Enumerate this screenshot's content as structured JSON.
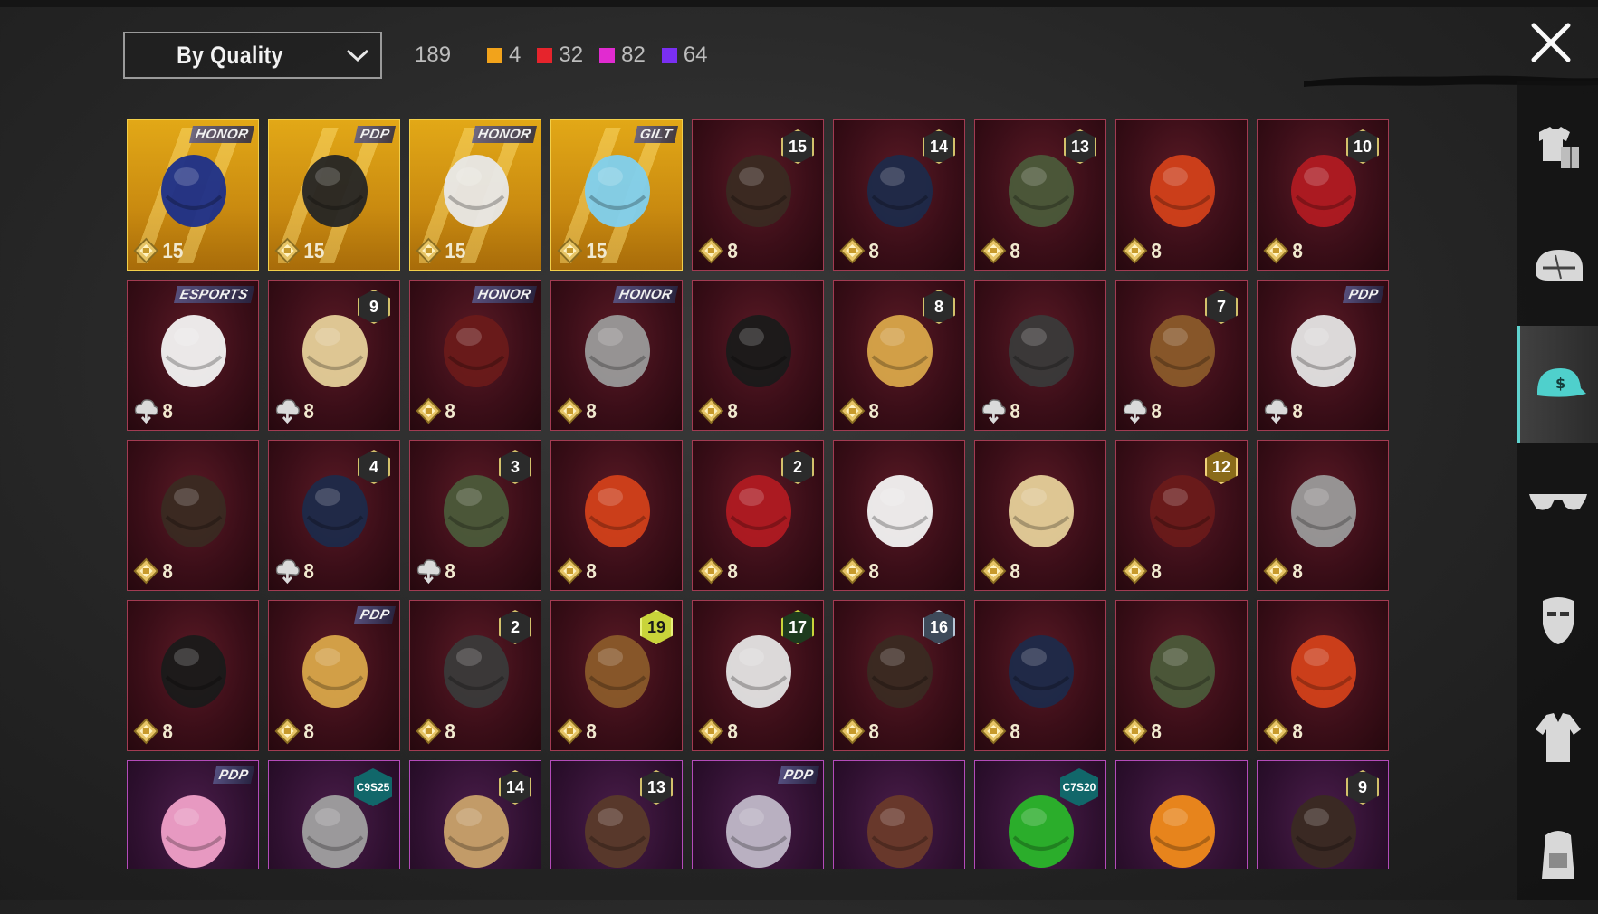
{
  "header": {
    "sort_label": "By Quality",
    "total_count": "189",
    "quality_counts": [
      {
        "color": "#f2a31b",
        "count": "4"
      },
      {
        "color": "#e6242c",
        "count": "32"
      },
      {
        "color": "#e12bd0",
        "count": "82"
      },
      {
        "color": "#7a2ff2",
        "count": "64"
      }
    ]
  },
  "items": [
    {
      "name": "chandelier-headpiece",
      "tier": "gold",
      "brand": "HONOR",
      "value": "15",
      "currency": "gold"
    },
    {
      "name": "cat-ear-headphones",
      "tier": "gold",
      "brand": "PDP",
      "value": "15",
      "currency": "gold"
    },
    {
      "name": "winged-crown",
      "tier": "gold",
      "brand": "HONOR",
      "value": "15",
      "currency": "gold"
    },
    {
      "name": "blue-veil",
      "tier": "gold",
      "brand": "GILT",
      "value": "15",
      "currency": "gold"
    },
    {
      "name": "blonde-pink-hair",
      "tier": "red",
      "level": "15",
      "value": "8",
      "currency": "gold"
    },
    {
      "name": "wolf-mask",
      "tier": "red",
      "level": "14",
      "value": "8",
      "currency": "gold"
    },
    {
      "name": "feathered-hat",
      "tier": "red",
      "level": "13",
      "value": "8",
      "currency": "gold"
    },
    {
      "name": "white-hair-horns",
      "tier": "red",
      "value": "8",
      "currency": "gold"
    },
    {
      "name": "dark-curly-hair",
      "tier": "red",
      "level": "10",
      "value": "8",
      "currency": "gold"
    },
    {
      "name": "plague-crow-hat",
      "tier": "red",
      "brand": "ESPORTS",
      "value": "8",
      "currency": "cloud"
    },
    {
      "name": "zombie-head",
      "tier": "red",
      "level": "9",
      "value": "8",
      "currency": "cloud"
    },
    {
      "name": "orange-hair",
      "tier": "red",
      "brand": "HONOR",
      "value": "8",
      "currency": "gold"
    },
    {
      "name": "red-hair",
      "tier": "red",
      "brand": "HONOR",
      "value": "8",
      "currency": "gold"
    },
    {
      "name": "white-cowboy-hat",
      "tier": "red",
      "value": "8",
      "currency": "gold"
    },
    {
      "name": "blonde-winged-hair",
      "tier": "red",
      "level": "8",
      "value": "8",
      "currency": "gold"
    },
    {
      "name": "demon-mask-hair",
      "tier": "red",
      "value": "8",
      "currency": "cloud"
    },
    {
      "name": "grey-long-hair",
      "tier": "red",
      "level": "7",
      "value": "8",
      "currency": "cloud"
    },
    {
      "name": "black-cube-head",
      "tier": "red",
      "brand": "PDP",
      "value": "8",
      "currency": "cloud"
    },
    {
      "name": "red-helmet",
      "tier": "red",
      "value": "8",
      "currency": "gold"
    },
    {
      "name": "snowman-top-hat",
      "tier": "red",
      "level": "4",
      "value": "8",
      "currency": "cloud"
    },
    {
      "name": "joker-green-hair",
      "tier": "red",
      "level": "3",
      "value": "8",
      "currency": "cloud"
    },
    {
      "name": "green-spiked-helmet",
      "tier": "red",
      "value": "8",
      "currency": "gold"
    },
    {
      "name": "cyan-bucket-hat",
      "tier": "red",
      "level": "2",
      "value": "8",
      "currency": "gold"
    },
    {
      "name": "dark-armor-helmet",
      "tier": "red",
      "value": "8",
      "currency": "gold"
    },
    {
      "name": "anubis-headdress",
      "tier": "red",
      "value": "8",
      "currency": "gold"
    },
    {
      "name": "winged-gold-mask",
      "tier": "red",
      "level": "12",
      "value": "8",
      "currency": "gold"
    },
    {
      "name": "gold-white-helmet",
      "tier": "red",
      "value": "8",
      "currency": "gold"
    },
    {
      "name": "lilac-bob-wig",
      "tier": "red",
      "value": "8",
      "currency": "gold"
    },
    {
      "name": "lace-bonnet",
      "tier": "red",
      "brand": "PDP",
      "value": "8",
      "currency": "gold"
    },
    {
      "name": "blue-mecha-helmet",
      "tier": "red",
      "level": "2",
      "value": "8",
      "currency": "gold"
    },
    {
      "name": "samurai-helmet",
      "tier": "red",
      "level": "19",
      "value": "8",
      "currency": "gold"
    },
    {
      "name": "gold-mask-dreads",
      "tier": "red",
      "level": "17",
      "value": "8",
      "currency": "gold"
    },
    {
      "name": "purple-cyber-helmet",
      "tier": "red",
      "level": "16",
      "value": "8",
      "currency": "gold"
    },
    {
      "name": "ghost-sheet",
      "tier": "red",
      "value": "8",
      "currency": "gold"
    },
    {
      "name": "pirate-bicorne",
      "tier": "red",
      "value": "8",
      "currency": "gold"
    },
    {
      "name": "orange-visor-helmet",
      "tier": "red",
      "value": "8",
      "currency": "gold"
    },
    {
      "name": "pink-bow-headband",
      "tier": "purple",
      "brand": "PDP"
    },
    {
      "name": "grey-hair-bun",
      "tier": "purple",
      "season": "C9S25"
    },
    {
      "name": "blonde-flower-hair",
      "tier": "purple",
      "level": "14"
    },
    {
      "name": "aviator-goggles-cap",
      "tier": "purple",
      "level": "13"
    },
    {
      "name": "silver-long-hair",
      "tier": "purple",
      "brand": "PDP"
    },
    {
      "name": "brown-horned-hair",
      "tier": "purple"
    },
    {
      "name": "green-pigtails",
      "tier": "purple",
      "season": "C7S20"
    },
    {
      "name": "pumpkin-head",
      "tier": "purple"
    },
    {
      "name": "dark-wavy-hair",
      "tier": "purple",
      "level": "9"
    }
  ],
  "sidebar": {
    "tabs": [
      {
        "name": "outfit-tab",
        "icon": "outfit-icon"
      },
      {
        "name": "helmet-tab",
        "icon": "helmet-icon"
      },
      {
        "name": "hat-tab",
        "icon": "cap-icon",
        "active": true
      },
      {
        "name": "eyewear-tab",
        "icon": "glasses-icon"
      },
      {
        "name": "mask-tab",
        "icon": "mask-icon"
      },
      {
        "name": "top-tab",
        "icon": "shirt-icon"
      },
      {
        "name": "backpack-tab",
        "icon": "backpack-icon"
      }
    ]
  }
}
